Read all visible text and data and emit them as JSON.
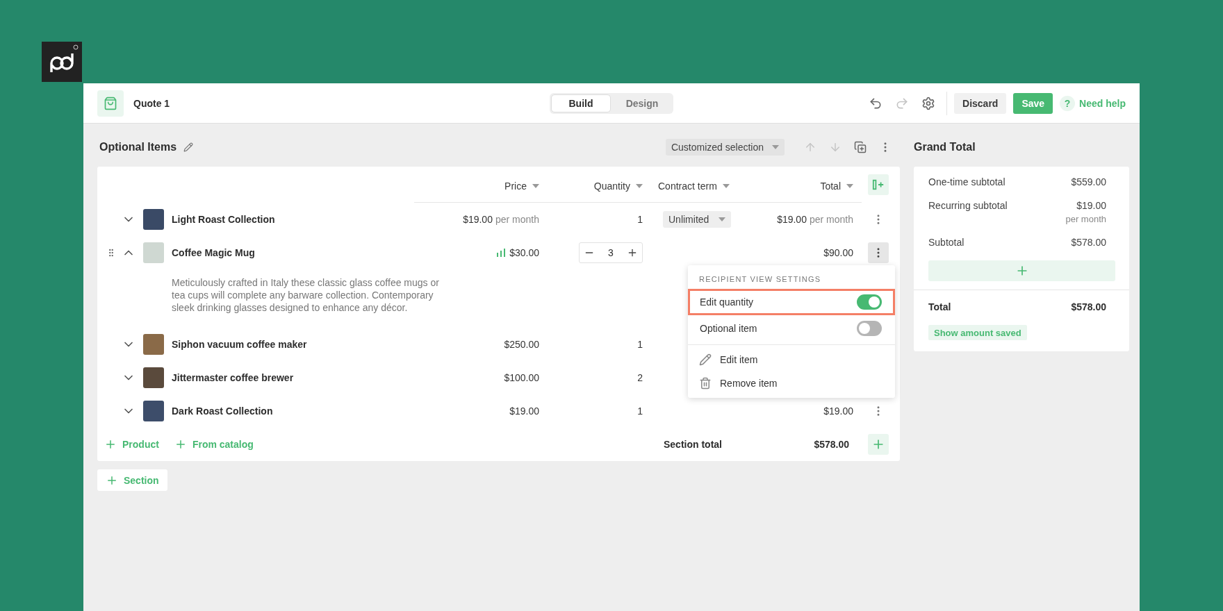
{
  "topbar": {
    "title": "Quote 1",
    "modes": [
      {
        "label": "Build",
        "selected": true
      },
      {
        "label": "Design",
        "selected": false
      }
    ],
    "undo": {
      "disabled": false
    },
    "redo": {
      "disabled": true
    },
    "buttons": [
      {
        "label": "Discard",
        "kind": "secondary"
      },
      {
        "label": "Save",
        "kind": "primary"
      }
    ],
    "help": {
      "icon": "?",
      "label": "Need help"
    }
  },
  "section": {
    "title": "Optional Items",
    "selection": "Customized selection",
    "move_up": {
      "disabled": true
    },
    "move_down": {
      "disabled": true
    }
  },
  "table": {
    "columns": [
      "Price",
      "Quantity",
      "Contract term",
      "Total"
    ],
    "rows": [
      {
        "name": "Light Roast Collection",
        "expanded": false,
        "drag_handle": false,
        "price": "$19.00",
        "price_unit": "per month",
        "pricing_indicator": false,
        "quantity": "1",
        "kind": "text",
        "contract_term": "Unlimited",
        "total": "$19.00",
        "total_unit": "per month",
        "menu_open": false
      },
      {
        "name": "Coffee Magic Mug",
        "expanded": true,
        "drag_handle": true,
        "price": "$30.00",
        "pricing_indicator": true,
        "quantity": "3",
        "kind": "stepper",
        "total": "$90.00",
        "menu_open": true,
        "description": "Meticulously crafted in Italy these classic glass coffee mugs or tea cups will complete any barware collection. Contemporary sleek drinking glasses designed to enhance any décor."
      },
      {
        "name": "Siphon vacuum coffee maker",
        "expanded": false,
        "drag_handle": false,
        "price": "$250.00",
        "pricing_indicator": false,
        "quantity": "1",
        "kind": "text"
      },
      {
        "name": "Jittermaster coffee brewer",
        "expanded": false,
        "drag_handle": false,
        "price": "$100.00",
        "pricing_indicator": false,
        "quantity": "2",
        "kind": "text"
      },
      {
        "name": "Dark Roast Collection",
        "expanded": false,
        "drag_handle": false,
        "price": "$19.00",
        "pricing_indicator": false,
        "quantity": "1",
        "kind": "text",
        "total": "$19.00",
        "menu_open": false
      }
    ],
    "add_links": [
      "Product",
      "From catalog"
    ],
    "section_total": {
      "label": "Section total",
      "value": "$578.00"
    }
  },
  "menu": {
    "heading": "RECIPIENT VIEW SETTINGS",
    "toggles": [
      {
        "label": "Edit quantity",
        "on": true,
        "highlighted": true
      },
      {
        "label": "Optional item",
        "on": false,
        "highlighted": false
      }
    ],
    "actions": [
      {
        "label": "Edit item",
        "kind": "edit"
      },
      {
        "label": "Remove item",
        "kind": "remove"
      }
    ]
  },
  "add_section": "Section",
  "grand_total": {
    "title": "Grand Total",
    "lines": [
      {
        "label": "One-time subtotal",
        "value": "$559.00"
      },
      {
        "label": "Recurring subtotal",
        "value": "$19.00",
        "unit": "per month"
      },
      {
        "label": "Subtotal",
        "value": "$578.00"
      }
    ],
    "total": {
      "label": "Total",
      "value": "$578.00"
    },
    "show_saved": "Show amount saved"
  }
}
